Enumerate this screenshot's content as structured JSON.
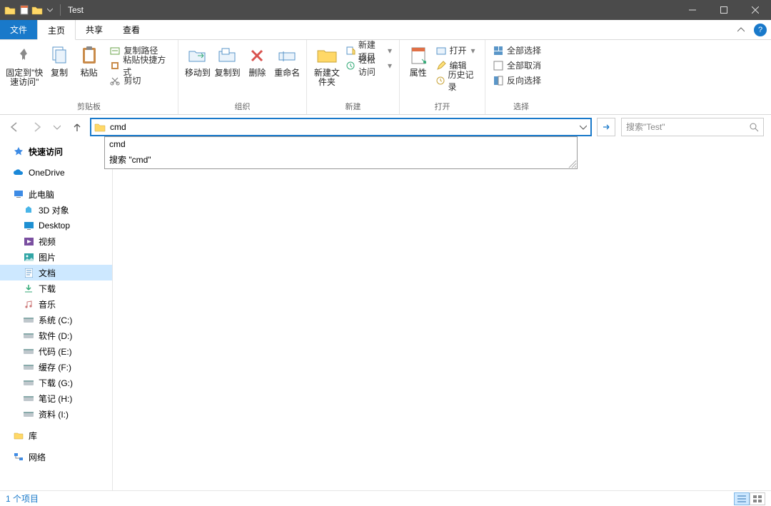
{
  "window": {
    "title": "Test"
  },
  "tabs": {
    "file": "文件",
    "home": "主页",
    "share": "共享",
    "view": "查看"
  },
  "ribbon": {
    "clipboard": {
      "pin": "固定到\"快速访问\"",
      "copy": "复制",
      "paste": "粘贴",
      "copy_path": "复制路径",
      "paste_shortcut": "粘贴快捷方式",
      "cut": "剪切",
      "group": "剪贴板"
    },
    "organize": {
      "move_to": "移动到",
      "copy_to": "复制到",
      "delete": "删除",
      "rename": "重命名",
      "group": "组织"
    },
    "new": {
      "new_folder": "新建文件夹",
      "new_item": "新建项目",
      "easy_access": "轻松访问",
      "group": "新建"
    },
    "open": {
      "properties": "属性",
      "open": "打开",
      "edit": "编辑",
      "history": "历史记录",
      "group": "打开"
    },
    "select": {
      "select_all": "全部选择",
      "select_none": "全部取消",
      "invert": "反向选择",
      "group": "选择"
    }
  },
  "address": {
    "value": "cmd",
    "suggestions": [
      "cmd",
      "搜索 \"cmd\""
    ]
  },
  "search": {
    "placeholder": "搜索\"Test\""
  },
  "sidebar": {
    "quick_access": "快速访问",
    "onedrive": "OneDrive",
    "this_pc": "此电脑",
    "items": [
      "3D 对象",
      "Desktop",
      "视频",
      "图片",
      "文档",
      "下载",
      "音乐",
      "系统 (C:)",
      "软件 (D:)",
      "代码 (E:)",
      "缓存 (F:)",
      "下载 (G:)",
      "笔记 (H:)",
      "资料 (I:)"
    ],
    "selected_index": 4,
    "library": "库",
    "network": "网络"
  },
  "status": {
    "count": "1 个项目"
  }
}
